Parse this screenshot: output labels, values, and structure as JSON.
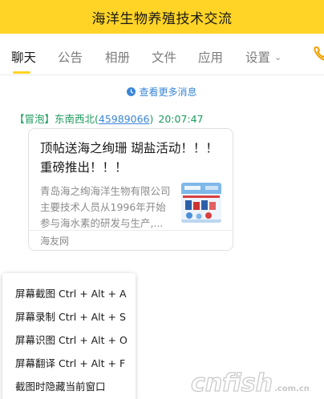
{
  "titlebar": {
    "title": "海洋生物养殖技术交流"
  },
  "tabs": [
    {
      "label": "聊天",
      "active": true
    },
    {
      "label": "公告"
    },
    {
      "label": "相册"
    },
    {
      "label": "文件"
    },
    {
      "label": "应用"
    },
    {
      "label": "设置"
    }
  ],
  "colors": {
    "brand_yellow": "#ffd426",
    "link_blue": "#3a86d6",
    "sender_green": "#1c9b5e"
  },
  "icons": {
    "more_messages": "clock-icon",
    "settings_dropdown": "chevron-down-icon",
    "call": "phone-icon"
  },
  "history": {
    "label": "查看更多消息"
  },
  "message": {
    "sender_prefix": "【冒泡】东南西北(",
    "sender_qq": "45989066",
    "sender_suffix": ")",
    "time": "20:07:47",
    "card": {
      "title": "顶帖送海之绚珊 瑚盐活动！！！ 重磅推出！！！",
      "description": "青岛海之绚海洋生物有限公司主要技术人员从1996年开始参与海水素的研发与生产,...",
      "source": "海友网"
    }
  },
  "context_menu": {
    "items": [
      "屏幕截图 Ctrl + Alt + A",
      "屏幕录制 Ctrl + Alt + S",
      "屏幕识图 Ctrl + Alt + O",
      "屏幕翻译 Ctrl + Alt + F",
      "截图时隐藏当前窗口"
    ]
  },
  "watermark": {
    "text": "cnfish",
    "domain_text": ".com.cn"
  }
}
